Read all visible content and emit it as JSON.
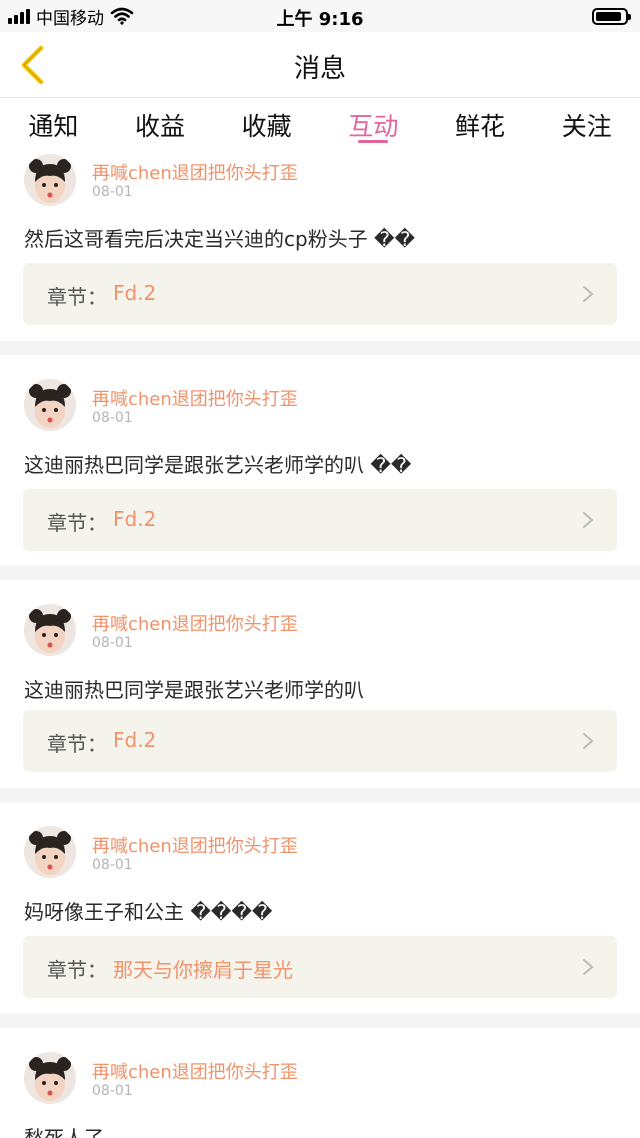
{
  "status_bar": {
    "carrier": "中国移动",
    "time": "上午 9:16",
    "battery_level": 0.9
  },
  "nav": {
    "title": "消息"
  },
  "tabs": [
    {
      "label": "通知"
    },
    {
      "label": "收益"
    },
    {
      "label": "收藏"
    },
    {
      "label": "互动",
      "active": true
    },
    {
      "label": "鲜花"
    },
    {
      "label": "关注"
    }
  ],
  "chapter_label": "章节：",
  "messages": [
    {
      "user": "再喊chen退团把你头打歪",
      "date": "08-01",
      "content": "然后这哥看完后决定当兴迪的cp粉头子 ��",
      "chapter": "Fd.2"
    },
    {
      "user": "再喊chen退团把你头打歪",
      "date": "08-01",
      "content": "这迪丽热巴同学是跟张艺兴老师学的叭 ��",
      "chapter": "Fd.2"
    },
    {
      "user": "再喊chen退团把你头打歪",
      "date": "08-01",
      "content": "这迪丽热巴同学是跟张艺兴老师学的叭",
      "chapter": "Fd.2"
    },
    {
      "user": "再喊chen退团把你头打歪",
      "date": "08-01",
      "content": "妈呀像王子和公主 ����",
      "chapter": "那天与你擦肩于星光"
    },
    {
      "user": "再喊chen退团把你头打歪",
      "date": "08-01",
      "content": "愁死人了",
      "chapter": ""
    }
  ],
  "colors": {
    "accent": "#e0659a",
    "user": "#f0926a",
    "back_icon": "#f5c400",
    "card_bg": "#f4f4ec"
  },
  "icons": {
    "back": "chevron-left-icon",
    "chapter_arrow": "chevron-right-icon"
  }
}
